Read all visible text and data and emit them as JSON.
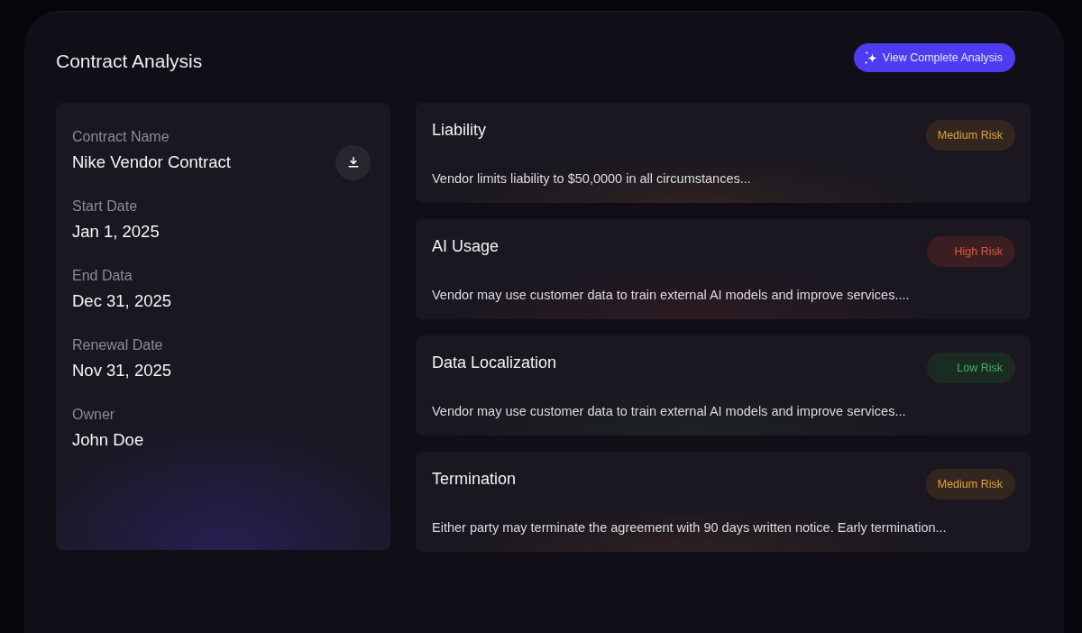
{
  "panel": {
    "title": "Contract Analysis",
    "action_button": "View Complete Analysis"
  },
  "details": [
    {
      "kind": "file",
      "label": "Contract Name",
      "value": "Nike Vendor Contract"
    },
    {
      "kind": "text",
      "label": "Start Date",
      "value": "Jan 1, 2025"
    },
    {
      "kind": "text",
      "label": "End Data",
      "value": "Dec 31, 2025"
    },
    {
      "kind": "text",
      "label": "Renewal Date",
      "value": "Nov 31, 2025"
    },
    {
      "kind": "text",
      "label": "Owner",
      "value": "John Doe"
    }
  ],
  "clauses": [
    {
      "kind": "medium",
      "title": "Liability",
      "risk": "Medium Risk",
      "description": "Vendor limits liability to $50,0000 in all circumstances..."
    },
    {
      "kind": "high",
      "title": "AI Usage",
      "risk": "High Risk",
      "description": "Vendor may use customer data to train external AI models and improve services...."
    },
    {
      "kind": "low",
      "title": "Data Localization",
      "risk": "Low Risk",
      "description": "Vendor may use customer data to train external AI models and improve services..."
    },
    {
      "kind": "medium",
      "title": "Termination",
      "risk": "Medium Risk",
      "description": "Either party may terminate the agreement with 90 days written notice. Early termination..."
    }
  ]
}
